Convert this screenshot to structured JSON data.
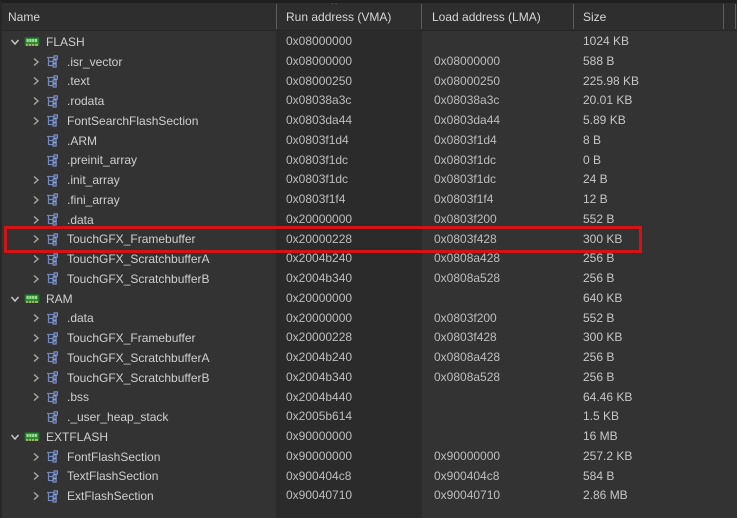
{
  "header": {
    "columns": [
      {
        "label": "Name"
      },
      {
        "label": "Run address (VMA)",
        "sorted": true,
        "sort_indicator": "^"
      },
      {
        "label": "Load address (LMA)"
      },
      {
        "label": "Size"
      }
    ]
  },
  "colors": {
    "body_bg": "#333333",
    "header_bg": "#2e2e2e",
    "sorted_column_bg": "#2b2b2b",
    "text": "#cccccc",
    "highlight_red": "#d41414",
    "memory_icon_green": "#3ba24b",
    "memory_icon_pins": "#d8b45a",
    "section_icon_blue": "#7189bc",
    "expander_gray": "#a8a8a8"
  },
  "icons": {
    "region": "memory-chip-icon",
    "section": "section-tree-icon",
    "collapsed": "chevron-right-icon",
    "expanded": "chevron-down-icon"
  },
  "rows": [
    {
      "name": "FLASH",
      "level": 0,
      "icon": "region",
      "expander": "expanded",
      "vma": "0x08000000",
      "lma": "",
      "size": "1024 KB"
    },
    {
      "name": ".isr_vector",
      "level": 1,
      "icon": "section",
      "expander": "collapsed",
      "vma": "0x08000000",
      "lma": "0x08000000",
      "size": "588 B"
    },
    {
      "name": ".text",
      "level": 1,
      "icon": "section",
      "expander": "collapsed",
      "vma": "0x08000250",
      "lma": "0x08000250",
      "size": "225.98 KB"
    },
    {
      "name": ".rodata",
      "level": 1,
      "icon": "section",
      "expander": "collapsed",
      "vma": "0x08038a3c",
      "lma": "0x08038a3c",
      "size": "20.01 KB"
    },
    {
      "name": "FontSearchFlashSection",
      "level": 1,
      "icon": "section",
      "expander": "collapsed",
      "vma": "0x0803da44",
      "lma": "0x0803da44",
      "size": "5.89 KB"
    },
    {
      "name": ".ARM",
      "level": 1,
      "icon": "section",
      "expander": "none",
      "vma": "0x0803f1d4",
      "lma": "0x0803f1d4",
      "size": "8 B"
    },
    {
      "name": ".preinit_array",
      "level": 1,
      "icon": "section",
      "expander": "none",
      "vma": "0x0803f1dc",
      "lma": "0x0803f1dc",
      "size": "0 B"
    },
    {
      "name": ".init_array",
      "level": 1,
      "icon": "section",
      "expander": "collapsed",
      "vma": "0x0803f1dc",
      "lma": "0x0803f1dc",
      "size": "24 B"
    },
    {
      "name": ".fini_array",
      "level": 1,
      "icon": "section",
      "expander": "collapsed",
      "vma": "0x0803f1f4",
      "lma": "0x0803f1f4",
      "size": "12 B"
    },
    {
      "name": ".data",
      "level": 1,
      "icon": "section",
      "expander": "collapsed",
      "vma": "0x20000000",
      "lma": "0x0803f200",
      "size": "552 B"
    },
    {
      "name": "TouchGFX_Framebuffer",
      "level": 1,
      "icon": "section",
      "expander": "collapsed",
      "vma": "0x20000228",
      "lma": "0x0803f428",
      "size": "300 KB",
      "highlighted": true
    },
    {
      "name": "TouchGFX_ScratchbufferA",
      "level": 1,
      "icon": "section",
      "expander": "collapsed",
      "vma": "0x2004b240",
      "lma": "0x0808a428",
      "size": "256 B"
    },
    {
      "name": "TouchGFX_ScratchbufferB",
      "level": 1,
      "icon": "section",
      "expander": "collapsed",
      "vma": "0x2004b340",
      "lma": "0x0808a528",
      "size": "256 B"
    },
    {
      "name": "RAM",
      "level": 0,
      "icon": "region",
      "expander": "expanded",
      "vma": "0x20000000",
      "lma": "",
      "size": "640 KB"
    },
    {
      "name": ".data",
      "level": 1,
      "icon": "section",
      "expander": "collapsed",
      "vma": "0x20000000",
      "lma": "0x0803f200",
      "size": "552 B"
    },
    {
      "name": "TouchGFX_Framebuffer",
      "level": 1,
      "icon": "section",
      "expander": "collapsed",
      "vma": "0x20000228",
      "lma": "0x0803f428",
      "size": "300 KB"
    },
    {
      "name": "TouchGFX_ScratchbufferA",
      "level": 1,
      "icon": "section",
      "expander": "collapsed",
      "vma": "0x2004b240",
      "lma": "0x0808a428",
      "size": "256 B"
    },
    {
      "name": "TouchGFX_ScratchbufferB",
      "level": 1,
      "icon": "section",
      "expander": "collapsed",
      "vma": "0x2004b340",
      "lma": "0x0808a528",
      "size": "256 B"
    },
    {
      "name": ".bss",
      "level": 1,
      "icon": "section",
      "expander": "collapsed",
      "vma": "0x2004b440",
      "lma": "",
      "size": "64.46 KB"
    },
    {
      "name": "._user_heap_stack",
      "level": 1,
      "icon": "section",
      "expander": "none",
      "vma": "0x2005b614",
      "lma": "",
      "size": "1.5 KB"
    },
    {
      "name": "EXTFLASH",
      "level": 0,
      "icon": "region",
      "expander": "expanded",
      "vma": "0x90000000",
      "lma": "",
      "size": "16 MB"
    },
    {
      "name": "FontFlashSection",
      "level": 1,
      "icon": "section",
      "expander": "collapsed",
      "vma": "0x90000000",
      "lma": "0x90000000",
      "size": "257.2 KB"
    },
    {
      "name": "TextFlashSection",
      "level": 1,
      "icon": "section",
      "expander": "collapsed",
      "vma": "0x900404c8",
      "lma": "0x900404c8",
      "size": "584 B"
    },
    {
      "name": "ExtFlashSection",
      "level": 1,
      "icon": "section",
      "expander": "collapsed",
      "vma": "0x90040710",
      "lma": "0x90040710",
      "size": "2.86 MB"
    }
  ]
}
